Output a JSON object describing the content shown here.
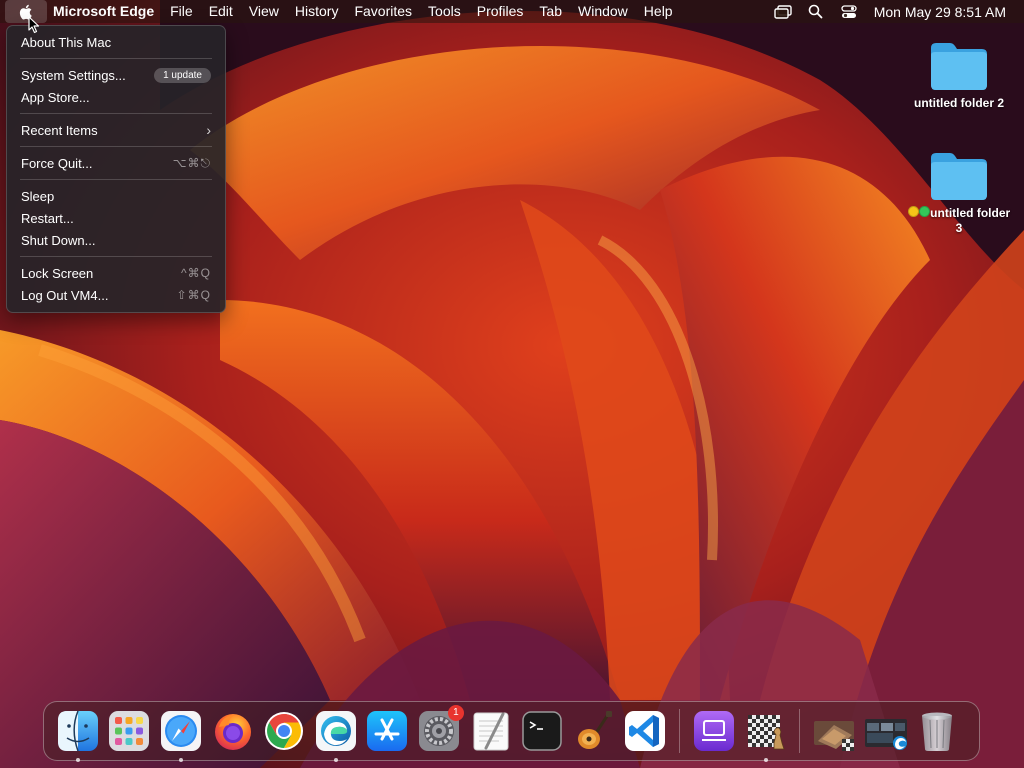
{
  "menubar": {
    "app_name": "Microsoft Edge",
    "items": [
      "File",
      "Edit",
      "View",
      "History",
      "Favorites",
      "Tools",
      "Profiles",
      "Tab",
      "Window",
      "Help"
    ],
    "clock": "Mon May 29  8:51 AM",
    "status_icons": [
      "screen-mirroring-icon",
      "spotlight-search-icon",
      "control-center-icon"
    ]
  },
  "apple_menu": {
    "about": "About This Mac",
    "system_settings": "System Settings...",
    "system_settings_badge": "1 update",
    "app_store": "App Store...",
    "recent_items": "Recent Items",
    "force_quit": "Force Quit...",
    "force_quit_shortcut": "⌥⌘⎋",
    "sleep": "Sleep",
    "restart": "Restart...",
    "shut_down": "Shut Down...",
    "lock_screen": "Lock Screen",
    "lock_screen_shortcut": "^⌘Q",
    "log_out": "Log Out VM4...",
    "log_out_shortcut": "⇧⌘Q"
  },
  "desktop": {
    "folder1": "untitled folder 2",
    "folder2": "untitled folder 3",
    "folder2_tags": [
      "#f5c518",
      "#34c759"
    ]
  },
  "dock": {
    "items": [
      "Finder",
      "Launchpad",
      "Safari",
      "Firefox",
      "Google Chrome",
      "Microsoft Edge",
      "App Store",
      "System Settings",
      "TextEdit",
      "Terminal",
      "GarageBand",
      "Visual Studio Code",
      "Mail Drop",
      "Chess",
      "Chess Window",
      "Edge Window",
      "Trash"
    ],
    "system_settings_badge": "1"
  },
  "colors": {
    "wallpaper_orange": "#f08a1c",
    "wallpaper_red": "#c2281c",
    "wallpaper_purple": "#5a1e4a",
    "folder_blue": "#4fb3ec"
  }
}
